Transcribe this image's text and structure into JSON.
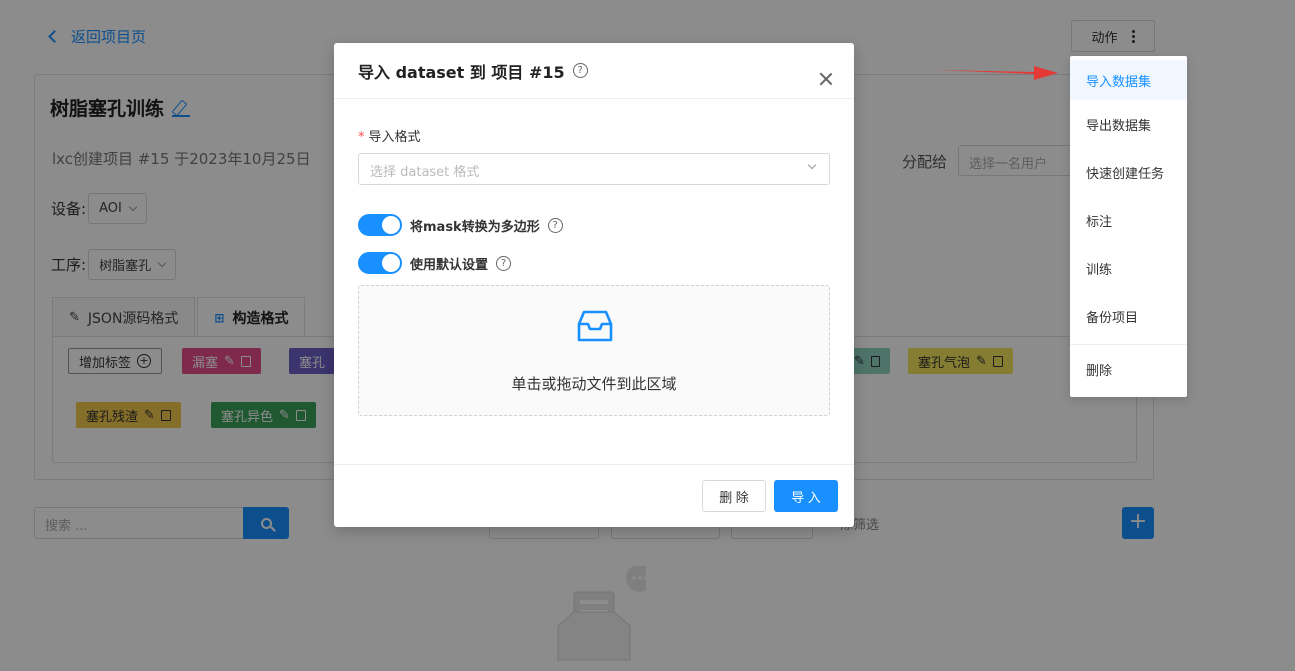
{
  "header": {
    "back_label": "返回项目页",
    "actions_label": "动作"
  },
  "project": {
    "title": "树脂塞孔训练",
    "subtitle": "lxc创建项目 #15 于2023年10月25日",
    "assign_label": "分配给",
    "assign_placeholder": "选择一名用户",
    "device_label": "设备:",
    "device_value": "AOI",
    "process_label": "工序:",
    "process_value": "树脂塞孔"
  },
  "tabs": [
    {
      "label": "JSON源码格式"
    },
    {
      "label": "构造格式"
    }
  ],
  "tags": {
    "add_label": "增加标签",
    "items": [
      {
        "label": "漏塞",
        "color": "#e74c8a"
      },
      {
        "label": "塞孔",
        "color": "#6c5fc7"
      },
      {
        "label": "塞孔气泡",
        "color": "#f0e35c"
      },
      {
        "label": "塞孔残渣",
        "color": "#f2c94c"
      },
      {
        "label": "塞孔异色",
        "color": "#3aa05a"
      }
    ]
  },
  "toolbar": {
    "search_placeholder": "搜索 ...",
    "filter_text": "除筛选"
  },
  "modal": {
    "title": "导入 dataset 到 项目 #15",
    "format_label": "导入格式",
    "format_placeholder": "选择 dataset 格式",
    "switch_mask_label": "将mask转换为多边形",
    "switch_default_label": "使用默认设置",
    "drop_text": "单击或拖动文件到此区域",
    "delete_label": "删 除",
    "import_label": "导 入"
  },
  "menu": {
    "items": [
      {
        "label": "导入数据集"
      },
      {
        "label": "导出数据集"
      },
      {
        "label": "快速创建任务"
      },
      {
        "label": "标注"
      },
      {
        "label": "训练"
      },
      {
        "label": "备份项目"
      },
      {
        "label": "删除"
      }
    ]
  },
  "colors": {
    "accent": "#1890ff",
    "required": "#ff4d4f",
    "arrow": "#e53935"
  }
}
